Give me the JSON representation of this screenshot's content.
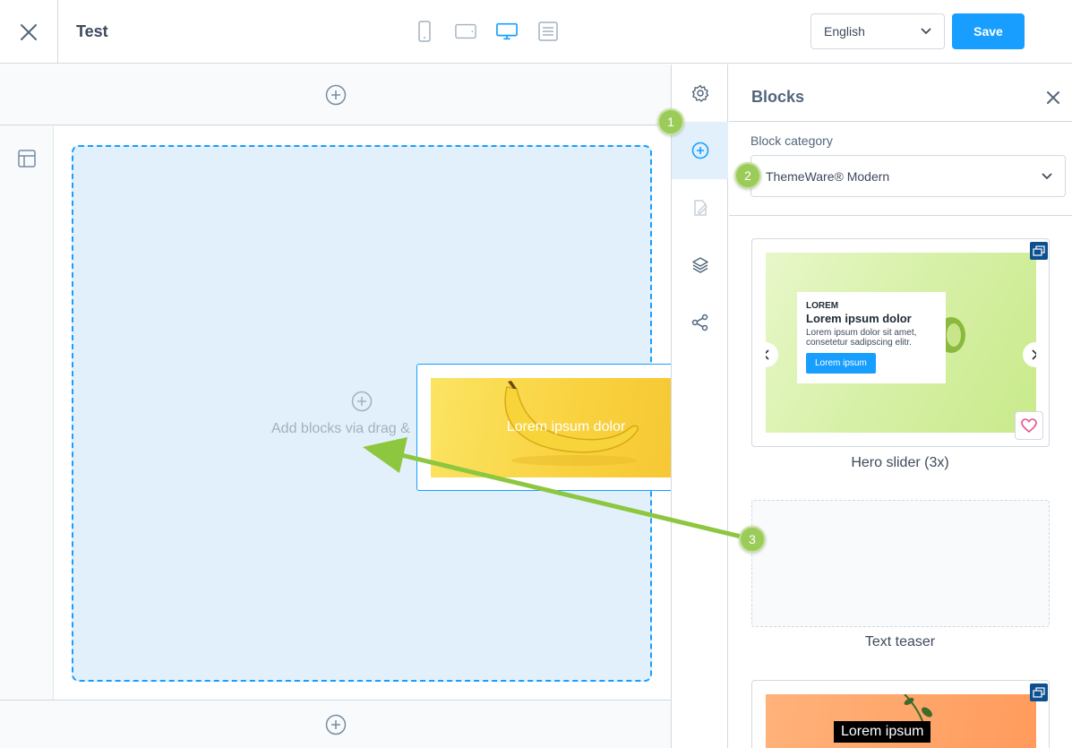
{
  "topbar": {
    "page_title": "Test",
    "language": "English",
    "save_label": "Save"
  },
  "canvas": {
    "drop_text": "Add blocks via drag &",
    "drag_ghost_text": "Lorem ipsum dolor"
  },
  "panel": {
    "title": "Blocks",
    "category_label": "Block category",
    "category_value": "ThemeWare® Modern",
    "blocks": [
      {
        "label": "Hero slider (3x)",
        "overline": "LOREM",
        "headline": "Lorem ipsum dolor",
        "body": "Lorem ipsum dolor sit amet, consetetur sadipscing elitr.",
        "button": "Lorem ipsum"
      },
      {
        "label": "Text teaser"
      },
      {
        "text": "Lorem ipsum"
      }
    ]
  },
  "annotations": {
    "step1": "1",
    "step2": "2",
    "step3": "3"
  },
  "colors": {
    "accent": "#189eff",
    "annotation": "#8dc63f",
    "badge": "#0c5090"
  }
}
